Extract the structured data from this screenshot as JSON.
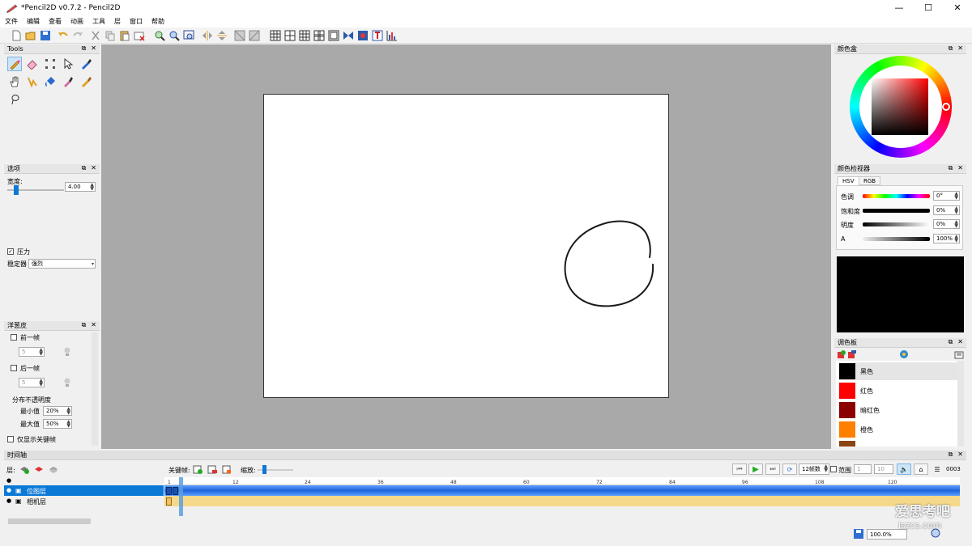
{
  "window": {
    "title": "*Pencil2D v0.7.2 - Pencil2D",
    "minimize": "—",
    "maximize": "☐",
    "close": "✕"
  },
  "menu": [
    "文件",
    "编辑",
    "查看",
    "动画",
    "工具",
    "层",
    "窗口",
    "帮助"
  ],
  "panels": {
    "tools": {
      "title": "Tools"
    },
    "options": {
      "title": "选项",
      "width_label": "宽度:",
      "width_value": "4.00",
      "pressure_label": "压力",
      "pressure_checked": true,
      "stabilizer_label": "稳定器",
      "stabilizer_value": "强烈"
    },
    "onion": {
      "title": "洋葱皮",
      "prev_label": "前一帧",
      "prev_value": "5",
      "next_label": "后一帧",
      "next_value": "5",
      "distribution_label": "分布不透明度",
      "min_label": "最小值",
      "min_value": "20%",
      "max_label": "最大值",
      "max_value": "50%",
      "keyframes_only_label": "仅显示关键帧"
    },
    "colorbox": {
      "title": "颜色盒"
    },
    "color_inspector": {
      "title": "颜色检视器",
      "tabs": [
        "HSV",
        "RGB"
      ],
      "rows": [
        {
          "label": "色调",
          "value": "0°"
        },
        {
          "label": "饱和度",
          "value": "0%"
        },
        {
          "label": "明度",
          "value": "0%"
        },
        {
          "label": "A",
          "value": "100%"
        }
      ],
      "preview_color": "#000000"
    },
    "palette": {
      "title": "调色板",
      "items": [
        {
          "name": "黑色",
          "color": "#000000"
        },
        {
          "name": "红色",
          "color": "#ff0000"
        },
        {
          "name": "暗红色",
          "color": "#8b0000"
        },
        {
          "name": "橙色",
          "color": "#ff8000"
        },
        {
          "name": "",
          "color": "#8b4513"
        }
      ]
    }
  },
  "timeline": {
    "title": "时间轴",
    "layers_label": "层:",
    "keyframe_label": "关键帧:",
    "zoom_label": "缩放:",
    "fps_value": "12帧数",
    "range_label": "范围",
    "range_start": "1",
    "range_end": "10",
    "frame_counter": "0003",
    "layers": [
      {
        "name": "位图层",
        "selected": true
      },
      {
        "name": "相机层",
        "selected": false
      }
    ],
    "ruler": [
      "1",
      "12",
      "24",
      "36",
      "48",
      "60",
      "72",
      "84",
      "96",
      "108",
      "120"
    ]
  },
  "status": {
    "zoom": "100.0%"
  },
  "watermark": {
    "line1": "爱思考吧",
    "line2": "iszcs.com"
  },
  "colors": {
    "accent": "#0a78d7",
    "canvas_bg": "#a9a9a9",
    "bitmap_track": "#1e64dc",
    "camera_track": "#f5d88a"
  }
}
